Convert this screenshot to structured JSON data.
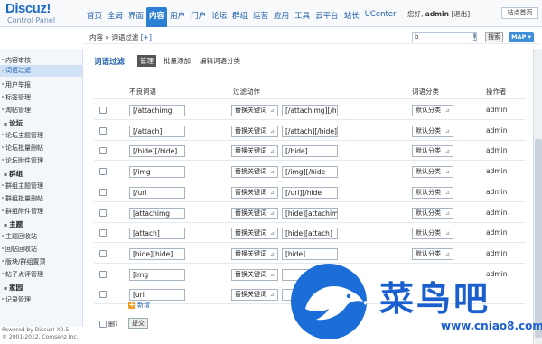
{
  "header": {
    "logo_name": "Discuz!",
    "logo_sub": "Control Panel",
    "nav": [
      "首页",
      "全局",
      "界面",
      "内容",
      "用户",
      "门户",
      "论坛",
      "群组",
      "运营",
      "应用",
      "工具",
      "云平台",
      "站长",
      "UCenter"
    ],
    "active_nav": "内容",
    "greeting_prefix": "您好,",
    "username": "admin",
    "logout": "[退出]",
    "home_button": "站点首页"
  },
  "subbar": {
    "breadcrumb": "内容 » 词语过滤",
    "add_label": "[+]",
    "search_value": "b",
    "search_button": "搜索",
    "map_button": "MAP ▾"
  },
  "sidebar": {
    "items": [
      {
        "label": "内容审核",
        "type": "item"
      },
      {
        "label": "词语过滤",
        "type": "item",
        "active": true
      },
      {
        "label": "用户举报",
        "type": "item"
      },
      {
        "label": "标签管理",
        "type": "item"
      },
      {
        "label": "淘帖管理",
        "type": "item"
      },
      {
        "label": "论坛",
        "type": "group"
      },
      {
        "label": "论坛主题管理",
        "type": "item"
      },
      {
        "label": "论坛批量删帖",
        "type": "item"
      },
      {
        "label": "论坛附件管理",
        "type": "item"
      },
      {
        "label": "群组",
        "type": "group"
      },
      {
        "label": "群组主题管理",
        "type": "item"
      },
      {
        "label": "群组批量删帖",
        "type": "item"
      },
      {
        "label": "群组附件管理",
        "type": "item"
      },
      {
        "label": "主题",
        "type": "group"
      },
      {
        "label": "主题回收站",
        "type": "item"
      },
      {
        "label": "回帖回收站",
        "type": "item"
      },
      {
        "label": "版块/群组置顶",
        "type": "item"
      },
      {
        "label": "帖子点评管理",
        "type": "item"
      },
      {
        "label": "家园",
        "type": "group"
      },
      {
        "label": "记录管理",
        "type": "item"
      }
    ],
    "footer_line1": "Powered by Discuz! X2.5",
    "footer_line2": "© 2001-2012, Comsenz Inc."
  },
  "main": {
    "title": "词语过滤",
    "tabs": [
      "管理",
      "批量添加",
      "编辑词语分类"
    ],
    "active_tab": "管理",
    "columns": [
      "不良词语",
      "过滤动作",
      "词语分类",
      "操作者"
    ],
    "rows": [
      {
        "word": "[/attachimg",
        "action": "替换关键词",
        "replace": "[/attachimg][/hi",
        "category": "默认分类",
        "operator": "admin"
      },
      {
        "word": "[/attach]",
        "action": "替换关键词",
        "replace": "[/attach][/hide]",
        "category": "默认分类",
        "operator": "admin"
      },
      {
        "word": "[/hide][/hide]",
        "action": "替换关键词",
        "replace": "[/hide]",
        "category": "默认分类",
        "operator": "admin"
      },
      {
        "word": "[/img",
        "action": "替换关键词",
        "replace": "[/img][/hide",
        "category": "默认分类",
        "operator": "admin"
      },
      {
        "word": "[/url",
        "action": "替换关键词",
        "replace": "[/url][/hide",
        "category": "默认分类",
        "operator": "admin"
      },
      {
        "word": "[attachimg",
        "action": "替换关键词",
        "replace": "[hide][attachimg",
        "category": "默认分类",
        "operator": "admin"
      },
      {
        "word": "[attach]",
        "action": "替换关键词",
        "replace": "[hide][attach]",
        "category": "默认分类",
        "operator": "admin"
      },
      {
        "word": "[hide][hide]",
        "action": "替换关键词",
        "replace": "[hide]",
        "category": "默认分类",
        "operator": "admin"
      },
      {
        "word": "[img",
        "action": "替换关键词",
        "replace": "",
        "category": "",
        "operator": "admin"
      },
      {
        "word": "[url",
        "action": "替换关键词",
        "replace": "",
        "category": "",
        "operator": ""
      }
    ],
    "add_label": "新增",
    "delete_label": "删?",
    "submit_label": "提交"
  },
  "watermark": {
    "text": "菜鸟吧",
    "url": "www.cniao8.com"
  }
}
